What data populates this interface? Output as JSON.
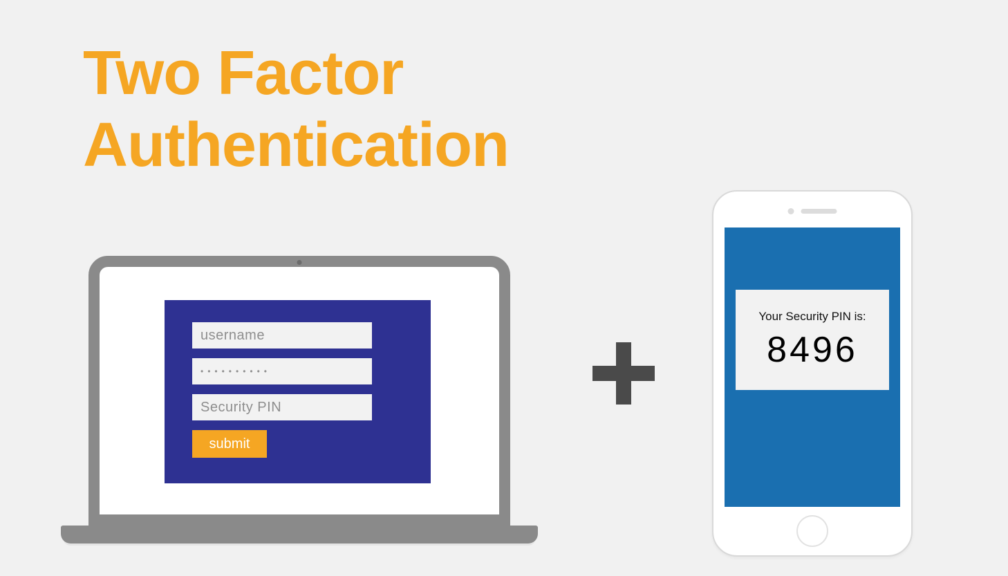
{
  "title": {
    "line1": "Two Factor",
    "line2": "Authentication"
  },
  "laptop": {
    "form": {
      "username_placeholder": "username",
      "password_value": "••••••••••",
      "pin_placeholder": "Security PIN",
      "submit_label": "submit"
    }
  },
  "phone": {
    "pin_label": "Your Security PIN is:",
    "pin_value": "8496"
  },
  "colors": {
    "accent": "#f5a623",
    "form_bg": "#2e3192",
    "phone_screen": "#1a6fb0",
    "plus": "#4a4a4a"
  }
}
